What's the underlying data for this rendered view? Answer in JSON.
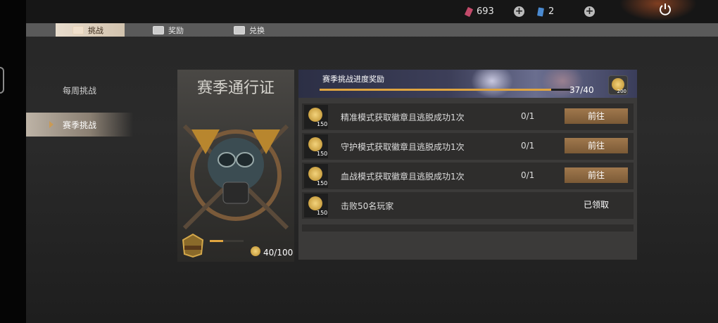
{
  "top": {
    "currency_1": "693",
    "currency_2": "2",
    "plus_symbol": "+",
    "icons": [
      "ticket-icon",
      "card-icon",
      "power-icon"
    ]
  },
  "tabs": [
    {
      "label": "挑战"
    },
    {
      "label": "奖励"
    },
    {
      "label": "兑换"
    }
  ],
  "sidebar": {
    "items": [
      {
        "label": "每周挑战"
      },
      {
        "label": "赛季挑战"
      }
    ]
  },
  "pass_card": {
    "title": "赛季通行证",
    "progress_text": "40/100",
    "progress_fraction": 0.4
  },
  "season_panel": {
    "banner_title": "赛季挑战进度奖励",
    "banner_progress_text": "37/40",
    "banner_progress_fraction": 0.925,
    "banner_reward_amount": "200",
    "rows": [
      {
        "label": "精准模式获取徽章且逃脱成功1次",
        "reward": "150",
        "progress": "0/1",
        "action": "前往"
      },
      {
        "label": "守护模式获取徽章且逃脱成功1次",
        "reward": "150",
        "progress": "0/1",
        "action": "前往"
      },
      {
        "label": "血战模式获取徽章且逃脱成功1次",
        "reward": "150",
        "progress": "0/1",
        "action": "前往"
      },
      {
        "label": "击败50名玩家",
        "reward": "150",
        "progress": "",
        "action": "已领取"
      }
    ]
  }
}
